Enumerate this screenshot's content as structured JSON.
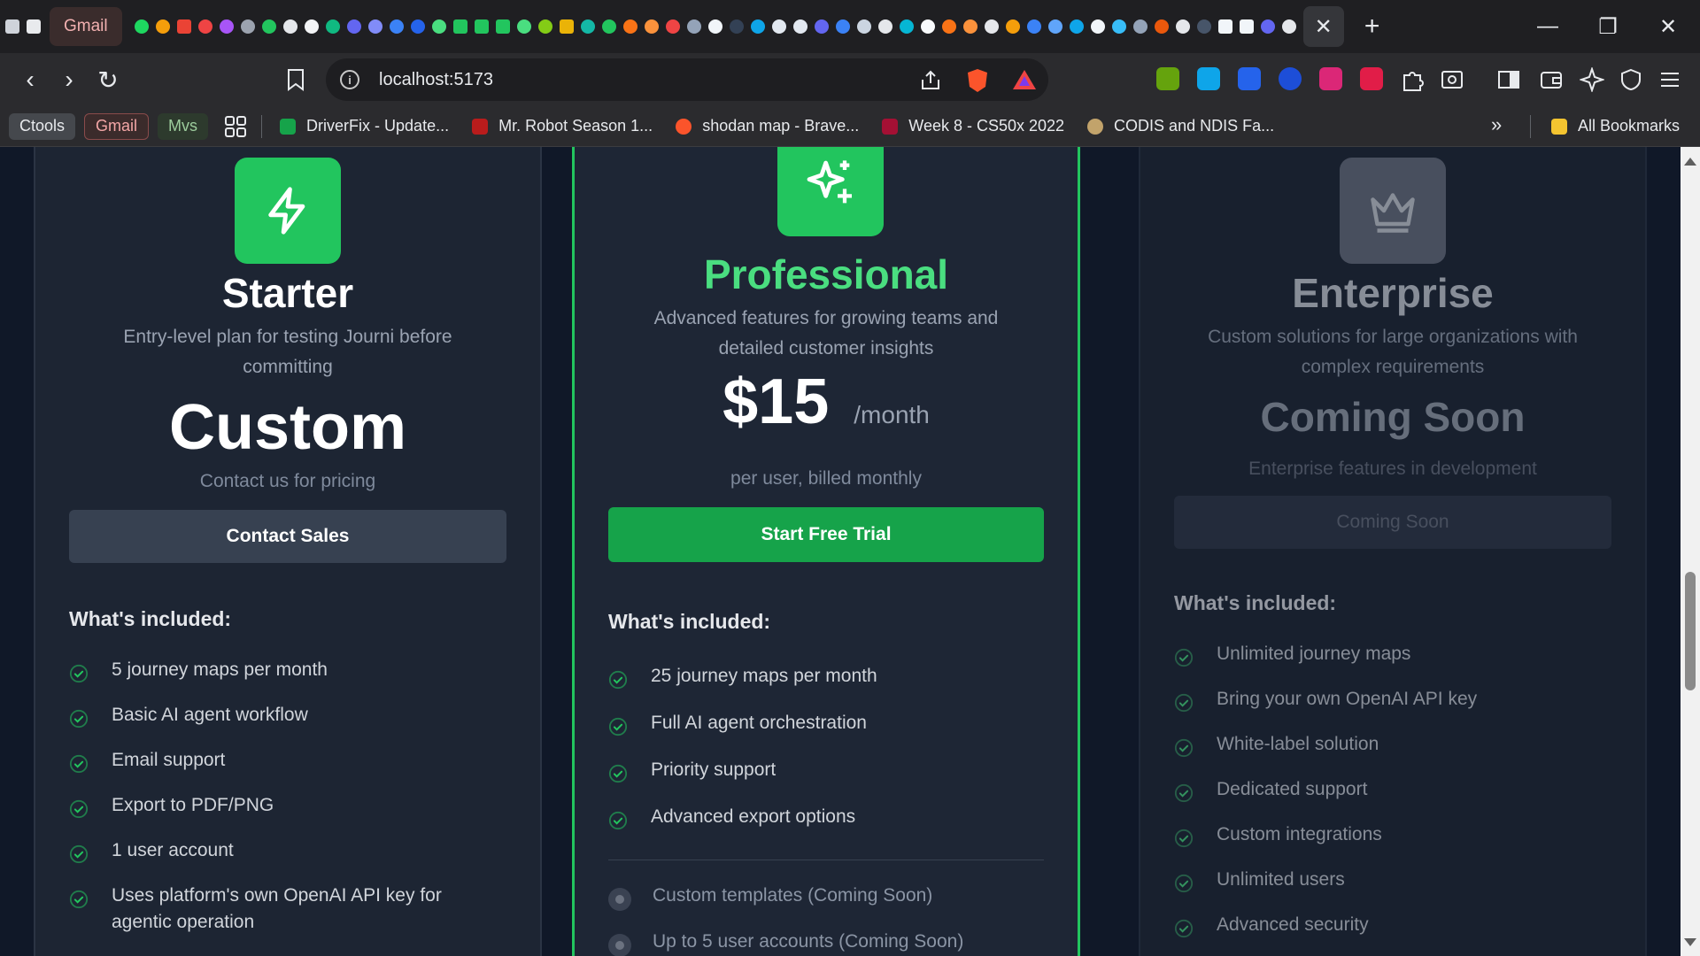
{
  "browser": {
    "active_tab_label": "Gmail",
    "url": "localhost:5173",
    "bookmarks": {
      "chips": [
        "Ctools",
        "Gmail",
        "Mvs"
      ],
      "items": [
        "DriverFix - Update...",
        "Mr. Robot Season 1...",
        "shodan map - Brave...",
        "Week 8 - CS50x 2022",
        "CODIS and NDIS Fa..."
      ],
      "overflow_icon": "double-chevron-right-icon",
      "all_bookmarks": "All Bookmarks"
    }
  },
  "plans": {
    "starter": {
      "icon": "lightning-icon",
      "name": "Starter",
      "description": "Entry-level plan for testing Journi before committing",
      "price": "Custom",
      "price_note": "Contact us for pricing",
      "cta": "Contact Sales",
      "included_title": "What's included:",
      "features": [
        "5 journey maps per month",
        "Basic AI agent workflow",
        "Email support",
        "Export to PDF/PNG",
        "1 user account",
        "Uses platform's own OpenAI API key for agentic operation"
      ]
    },
    "professional": {
      "icon": "sparkles-icon",
      "name": "Professional",
      "description": "Advanced features for growing teams and detailed customer insights",
      "price": "$15",
      "price_unit": "/month",
      "price_note": "per user, billed monthly",
      "cta": "Start Free Trial",
      "included_title": "What's included:",
      "features": [
        "25 journey maps per month",
        "Full AI agent orchestration",
        "Priority support",
        "Advanced export options"
      ],
      "coming_soon_features": [
        "Custom templates (Coming Soon)",
        "Up to 5 user accounts (Coming Soon)"
      ]
    },
    "enterprise": {
      "icon": "crown-icon",
      "name": "Enterprise",
      "description": "Custom solutions for large organizations with complex requirements",
      "price": "Coming Soon",
      "price_note": "Enterprise features in development",
      "cta": "Coming Soon",
      "included_title": "What's included:",
      "features": [
        "Unlimited journey maps",
        "Bring your own OpenAI API key",
        "White-label solution",
        "Dedicated support",
        "Custom integrations",
        "Unlimited users",
        "Advanced security"
      ]
    }
  },
  "colors": {
    "accent_green": "#22c55e",
    "button_green": "#16a34a",
    "page_bg": "#101828",
    "card_bg": "#1d2533"
  }
}
